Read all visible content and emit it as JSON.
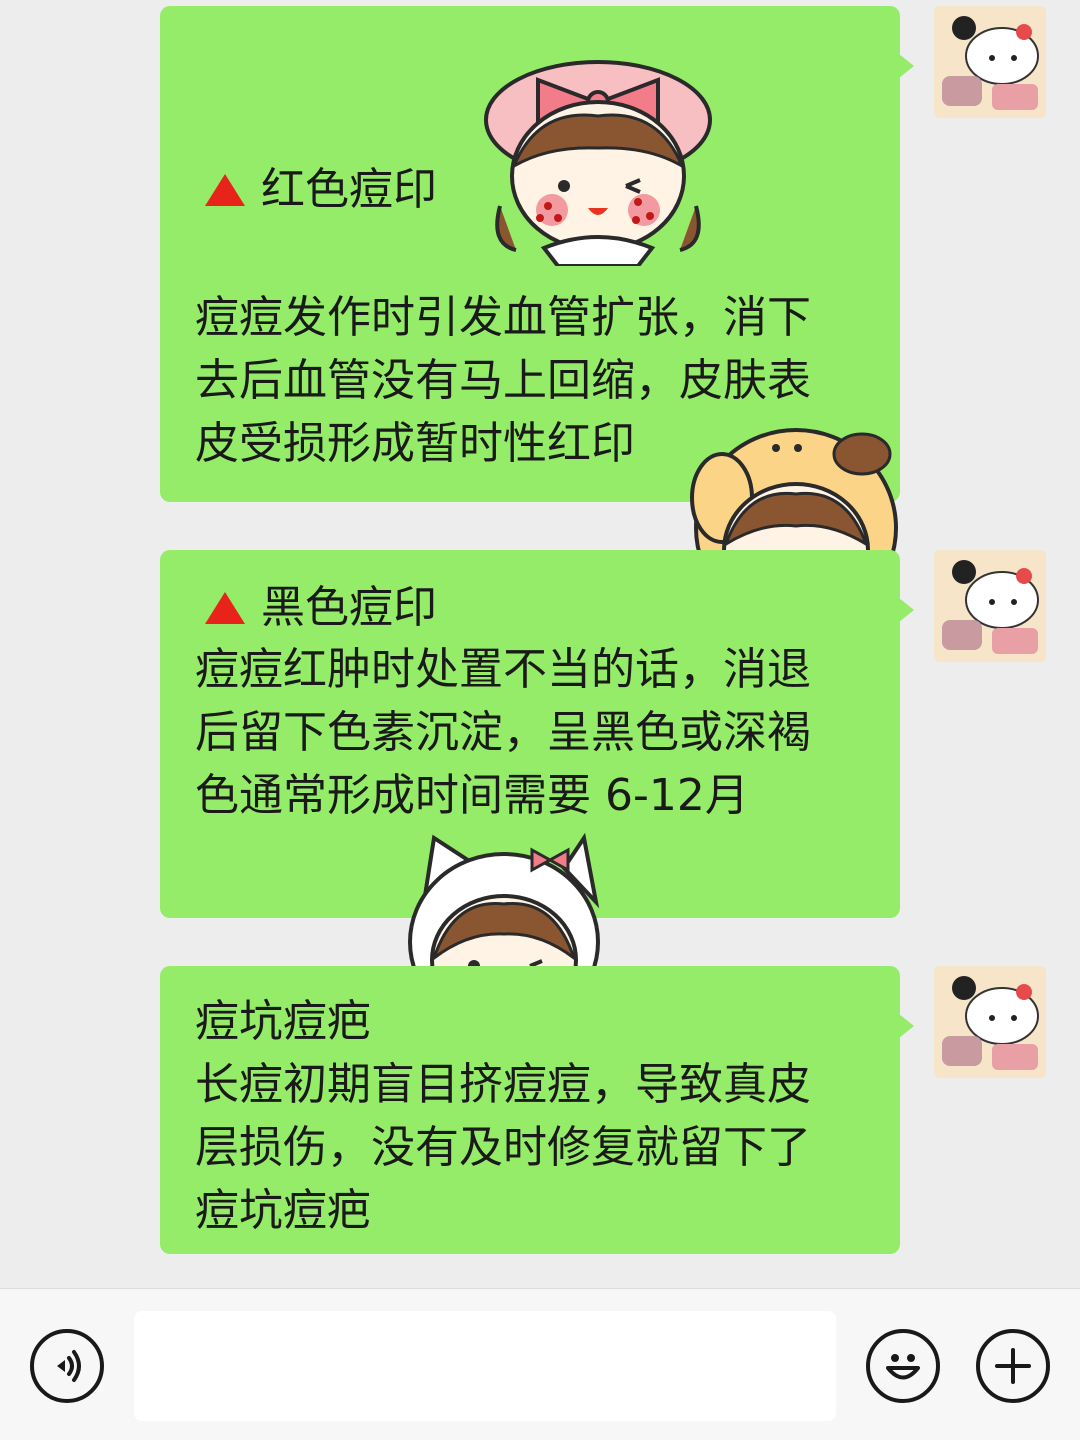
{
  "messages": [
    {
      "heading": "红色痘印",
      "heading_icon": "red-triangle-icon",
      "body": "痘痘发作时引发血管扩张，消下\n去后血管没有马上回缩，皮肤表\n皮受损形成暂时性红印"
    },
    {
      "heading": "黑色痘印",
      "heading_icon": "red-triangle-icon",
      "body": "痘痘红肿时处置不当的话，消退\n后留下色素沉淀，呈黑色或深褐\n色通常形成时间需要 6-12月"
    },
    {
      "heading": "痘坑痘疤",
      "body": "长痘初期盲目挤痘痘，导致真皮\n层损伤，没有及时修复就留下了\n痘坑痘疤"
    }
  ],
  "colors": {
    "bubble": "#95ec69",
    "background": "#ededed",
    "triangle": "#e8231a"
  },
  "input_bar": {
    "left_icon": "voice-icon",
    "right_icons": [
      "emoji-icon",
      "plus-icon"
    ],
    "input_value": ""
  }
}
